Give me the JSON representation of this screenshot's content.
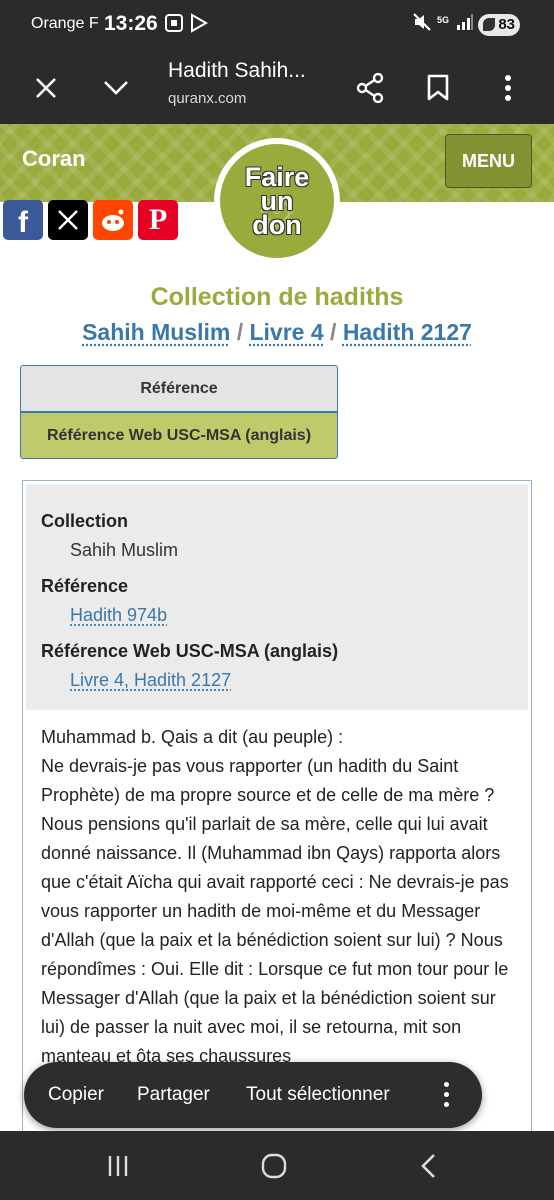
{
  "status_bar": {
    "carrier": "Orange F",
    "time": "13:26",
    "network": "5G",
    "battery": "83"
  },
  "browser": {
    "title": "Hadith Sahih...",
    "domain": "quranx.com"
  },
  "site": {
    "brand": "Coran",
    "menu_label": "MENU",
    "donate_label": "Faire un don",
    "social": [
      "facebook-icon",
      "x-icon",
      "reddit-icon",
      "pinterest-icon"
    ],
    "accent_color": "#9aab3e",
    "link_color": "#3a78a9"
  },
  "page": {
    "title": "Collection de hadiths",
    "breadcrumb": {
      "collection": "Sahih Muslim",
      "separator": "/",
      "book": "Livre 4",
      "hadith": "Hadith 2127"
    },
    "tabs": [
      "Référence",
      "Référence Web USC-MSA (anglais)"
    ]
  },
  "reference": {
    "collection_label": "Collection",
    "collection_value": "Sahih Muslim",
    "reference_label": "Référence",
    "reference_value": "Hadith 974b",
    "web_label": "Référence Web USC-MSA (anglais)",
    "web_value": "Livre 4, Hadith 2127"
  },
  "hadith": {
    "intro": "Muhammad b. Qais a dit (au peuple) :",
    "body": "Ne devrais-je pas vous rapporter (un hadith du Saint Prophète) de ma propre source et de celle de ma mère ? Nous pensions qu'il parlait de sa mère, celle qui lui avait donné naissance. Il (Muhammad ibn Qays) rapporta alors que c'était Aïcha qui avait rapporté ceci : Ne devrais-je pas vous rapporter un hadith de moi-même et du Messager d'Allah (que la paix et la bénédiction soient sur lui) ? Nous répondîmes : Oui. Elle dit : Lorsque ce fut mon tour pour le Messager d'Allah (que la paix et la bénédiction soient sur lui) de passer la nuit avec moi, il se retourna, mit son manteau et ôta ses chaussures"
  },
  "context_menu": {
    "copy": "Copier",
    "share": "Partager",
    "select_all": "Tout sélectionner"
  }
}
